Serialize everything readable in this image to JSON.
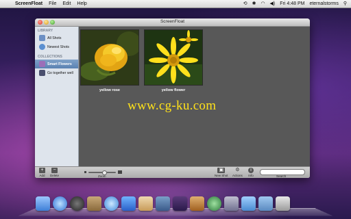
{
  "menubar": {
    "app_name": "ScreenFloat",
    "menus": [
      "File",
      "Edit",
      "Help"
    ],
    "clock": "Fri 4:48 PM",
    "user": "eternalstorms"
  },
  "window": {
    "title": "ScreenFloat",
    "sidebar": {
      "library_label": "LIBRARY",
      "library_items": [
        "All Shots",
        "Newest Shots"
      ],
      "collections_label": "COLLECTIONS",
      "collection_items": [
        "Smart Flowers",
        "Go together well"
      ]
    },
    "shots": [
      {
        "caption": "yellow rose"
      },
      {
        "caption": "yellow flower"
      }
    ],
    "toolbar": {
      "add": "Add",
      "delete": "Delete",
      "zoom": "Zoom",
      "new_shot": "New Shot",
      "actions": "Actions",
      "info": "Info",
      "search": "Search"
    }
  },
  "watermark": "www.cg-ku.com",
  "colors": {
    "selection": "#5a81b2",
    "content_bg": "#585858",
    "watermark": "#ffe11a"
  }
}
